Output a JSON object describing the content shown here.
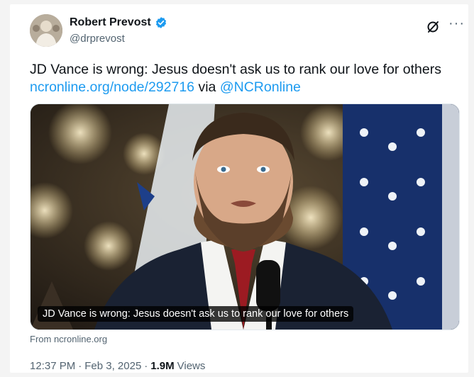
{
  "author": {
    "display_name": "Robert Prevost",
    "handle": "@drprevost",
    "verified": true
  },
  "header_icons": [
    "grok-icon",
    "more-icon"
  ],
  "more_label": "···",
  "tweet": {
    "text_line": "JD Vance is wrong: Jesus doesn't ask us to rank our love for others",
    "link": "ncronline.org/node/292716",
    "via_word": "via",
    "mention": "@NCRonline"
  },
  "media": {
    "caption": "JD Vance is wrong: Jesus doesn't ask us to rank our love for others"
  },
  "source_text": "From ncronline.org",
  "meta": {
    "time": "12:37 PM",
    "separator1": "·",
    "date": "Feb 3, 2025",
    "separator2": "·",
    "views_count": "1.9M",
    "views_label": "Views"
  },
  "colors": {
    "link": "#1d9bf0",
    "verified": "#1d9bf0",
    "text": "#0f1419",
    "secondary": "#536471"
  }
}
